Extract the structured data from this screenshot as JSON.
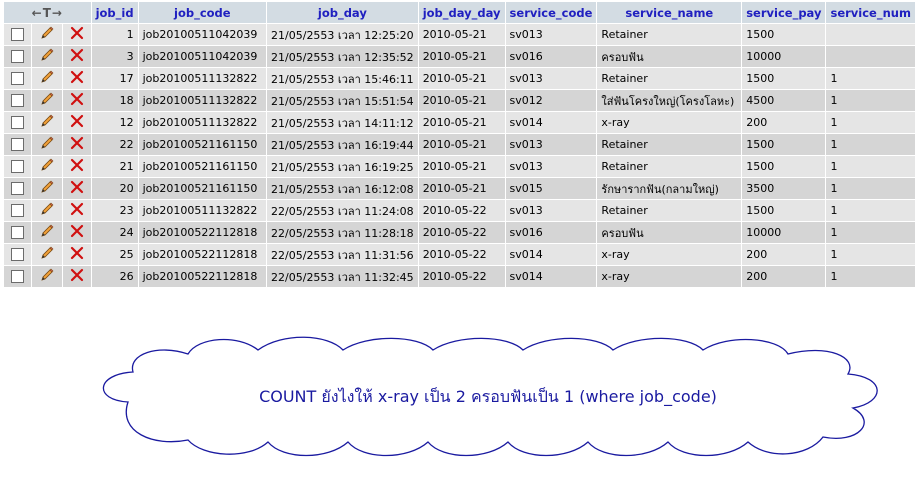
{
  "table": {
    "header_arrows": "←T→",
    "columns": [
      "job_id",
      "job_code",
      "job_day",
      "job_day_day",
      "service_code",
      "service_name",
      "service_pay",
      "service_num"
    ],
    "rows": [
      {
        "job_id": "1",
        "job_code": "job20100511042039",
        "job_day": "21/05/2553 เวลา 12:25:20",
        "job_day_day": "2010-05-21",
        "service_code": "sv013",
        "service_name": "Retainer",
        "service_pay": "1500",
        "service_num": ""
      },
      {
        "job_id": "3",
        "job_code": "job20100511042039",
        "job_day": "21/05/2553 เวลา 12:35:52",
        "job_day_day": "2010-05-21",
        "service_code": "sv016",
        "service_name": "ครอบฟัน",
        "service_pay": "10000",
        "service_num": ""
      },
      {
        "job_id": "17",
        "job_code": "job20100511132822",
        "job_day": "21/05/2553 เวลา 15:46:11",
        "job_day_day": "2010-05-21",
        "service_code": "sv013",
        "service_name": "Retainer",
        "service_pay": "1500",
        "service_num": "1"
      },
      {
        "job_id": "18",
        "job_code": "job20100511132822",
        "job_day": "21/05/2553 เวลา 15:51:54",
        "job_day_day": "2010-05-21",
        "service_code": "sv012",
        "service_name": "ใส่ฟันโครงใหญ่(โครงโลหะ)",
        "service_pay": "4500",
        "service_num": "1"
      },
      {
        "job_id": "12",
        "job_code": "job20100511132822",
        "job_day": "21/05/2553 เวลา 14:11:12",
        "job_day_day": "2010-05-21",
        "service_code": "sv014",
        "service_name": "x-ray",
        "service_pay": "200",
        "service_num": "1"
      },
      {
        "job_id": "22",
        "job_code": "job20100521161150",
        "job_day": "21/05/2553 เวลา 16:19:44",
        "job_day_day": "2010-05-21",
        "service_code": "sv013",
        "service_name": "Retainer",
        "service_pay": "1500",
        "service_num": "1"
      },
      {
        "job_id": "21",
        "job_code": "job20100521161150",
        "job_day": "21/05/2553 เวลา 16:19:25",
        "job_day_day": "2010-05-21",
        "service_code": "sv013",
        "service_name": "Retainer",
        "service_pay": "1500",
        "service_num": "1"
      },
      {
        "job_id": "20",
        "job_code": "job20100521161150",
        "job_day": "21/05/2553 เวลา 16:12:08",
        "job_day_day": "2010-05-21",
        "service_code": "sv015",
        "service_name": "รักษารากฟัน(กลามใหญ่)",
        "service_pay": "3500",
        "service_num": "1"
      },
      {
        "job_id": "23",
        "job_code": "job20100511132822",
        "job_day": "22/05/2553 เวลา 11:24:08",
        "job_day_day": "2010-05-22",
        "service_code": "sv013",
        "service_name": "Retainer",
        "service_pay": "1500",
        "service_num": "1"
      },
      {
        "job_id": "24",
        "job_code": "job20100522112818",
        "job_day": "22/05/2553 เวลา 11:28:18",
        "job_day_day": "2010-05-22",
        "service_code": "sv016",
        "service_name": "ครอบฟัน",
        "service_pay": "10000",
        "service_num": "1"
      },
      {
        "job_id": "25",
        "job_code": "job20100522112818",
        "job_day": "22/05/2553 เวลา 11:31:56",
        "job_day_day": "2010-05-22",
        "service_code": "sv014",
        "service_name": "x-ray",
        "service_pay": "200",
        "service_num": "1"
      },
      {
        "job_id": "26",
        "job_code": "job20100522112818",
        "job_day": "22/05/2553 เวลา 11:32:45",
        "job_day_day": "2010-05-22",
        "service_code": "sv014",
        "service_name": "x-ray",
        "service_pay": "200",
        "service_num": "1"
      }
    ]
  },
  "annotation": {
    "text": "COUNT ยังไงให้ x-ray เป็น 2 ครอบฟันเป็น 1 (where job_code)"
  },
  "icons": {
    "checkbox": "checkbox-icon",
    "edit": "pencil-icon",
    "delete": "red-x-icon",
    "cloud": "cloud-shape"
  },
  "colors": {
    "header_bg": "#d3dce3",
    "header_text": "#2020c0",
    "row_odd": "#e5e5e5",
    "row_even": "#d5d5d5",
    "delete_red": "#d01010",
    "annotation_text": "#1a1aa0"
  }
}
